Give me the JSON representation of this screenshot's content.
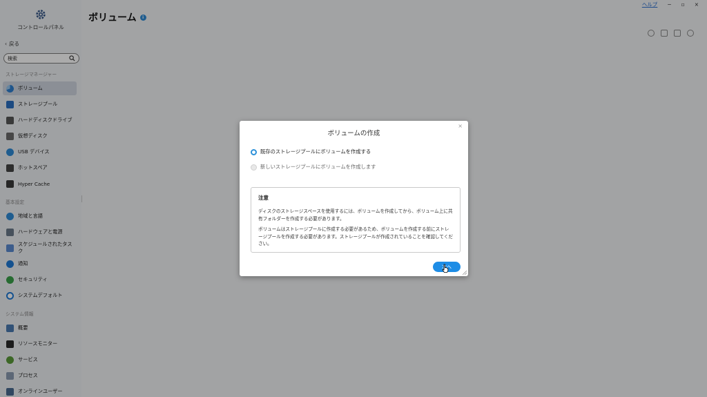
{
  "window": {
    "help": "ヘルプ",
    "minimize": "−",
    "restore": "▫",
    "close": "×"
  },
  "sidebar": {
    "title": "コントロールパネル",
    "back": "戻る",
    "search_placeholder": "検索",
    "sections": [
      {
        "label": "ストレージマネージャー"
      },
      {
        "label": "基本設定"
      },
      {
        "label": "システム情報"
      }
    ],
    "items": [
      {
        "label": "ボリューム",
        "active": true
      },
      {
        "label": "ストレージプール"
      },
      {
        "label": "ハードディスクドライブ"
      },
      {
        "label": "仮想ディスク"
      },
      {
        "label": "USB デバイス"
      },
      {
        "label": "ホットスペア"
      },
      {
        "label": "Hyper Cache"
      },
      {
        "label": "地域と言語"
      },
      {
        "label": "ハードウェアと電源"
      },
      {
        "label": "スケジュールされたタスク"
      },
      {
        "label": "通知"
      },
      {
        "label": "セキュリティ"
      },
      {
        "label": "システムデフォルト"
      },
      {
        "label": "概要"
      },
      {
        "label": "リソースモニター"
      },
      {
        "label": "サービス"
      },
      {
        "label": "プロセス"
      },
      {
        "label": "オンラインユーザー"
      }
    ]
  },
  "header": {
    "title": "ボリューム",
    "info": "i"
  },
  "dialog": {
    "title": "ボリュームの作成",
    "close": "×",
    "option1": "既存のストレージプールにボリュームを作成する",
    "option2": "新しいストレージプールにボリュームを作成します",
    "note_title": "注意",
    "note_p1": "ディスクのストレージスペースを使用するには、ボリュームを作成してから、ボリューム上に共有フォルダーを作成する必要があります。",
    "note_p2": "ボリュームはストレージプールに作成する必要があるため、ボリュームを作成する前にストレージプールを作成する必要があります。ストレージプールが作成されていることを確認してください。",
    "next": "次へ"
  },
  "colors": {
    "accent": "#1e8de6",
    "overlay": "rgba(0,0,0,0.33)"
  }
}
